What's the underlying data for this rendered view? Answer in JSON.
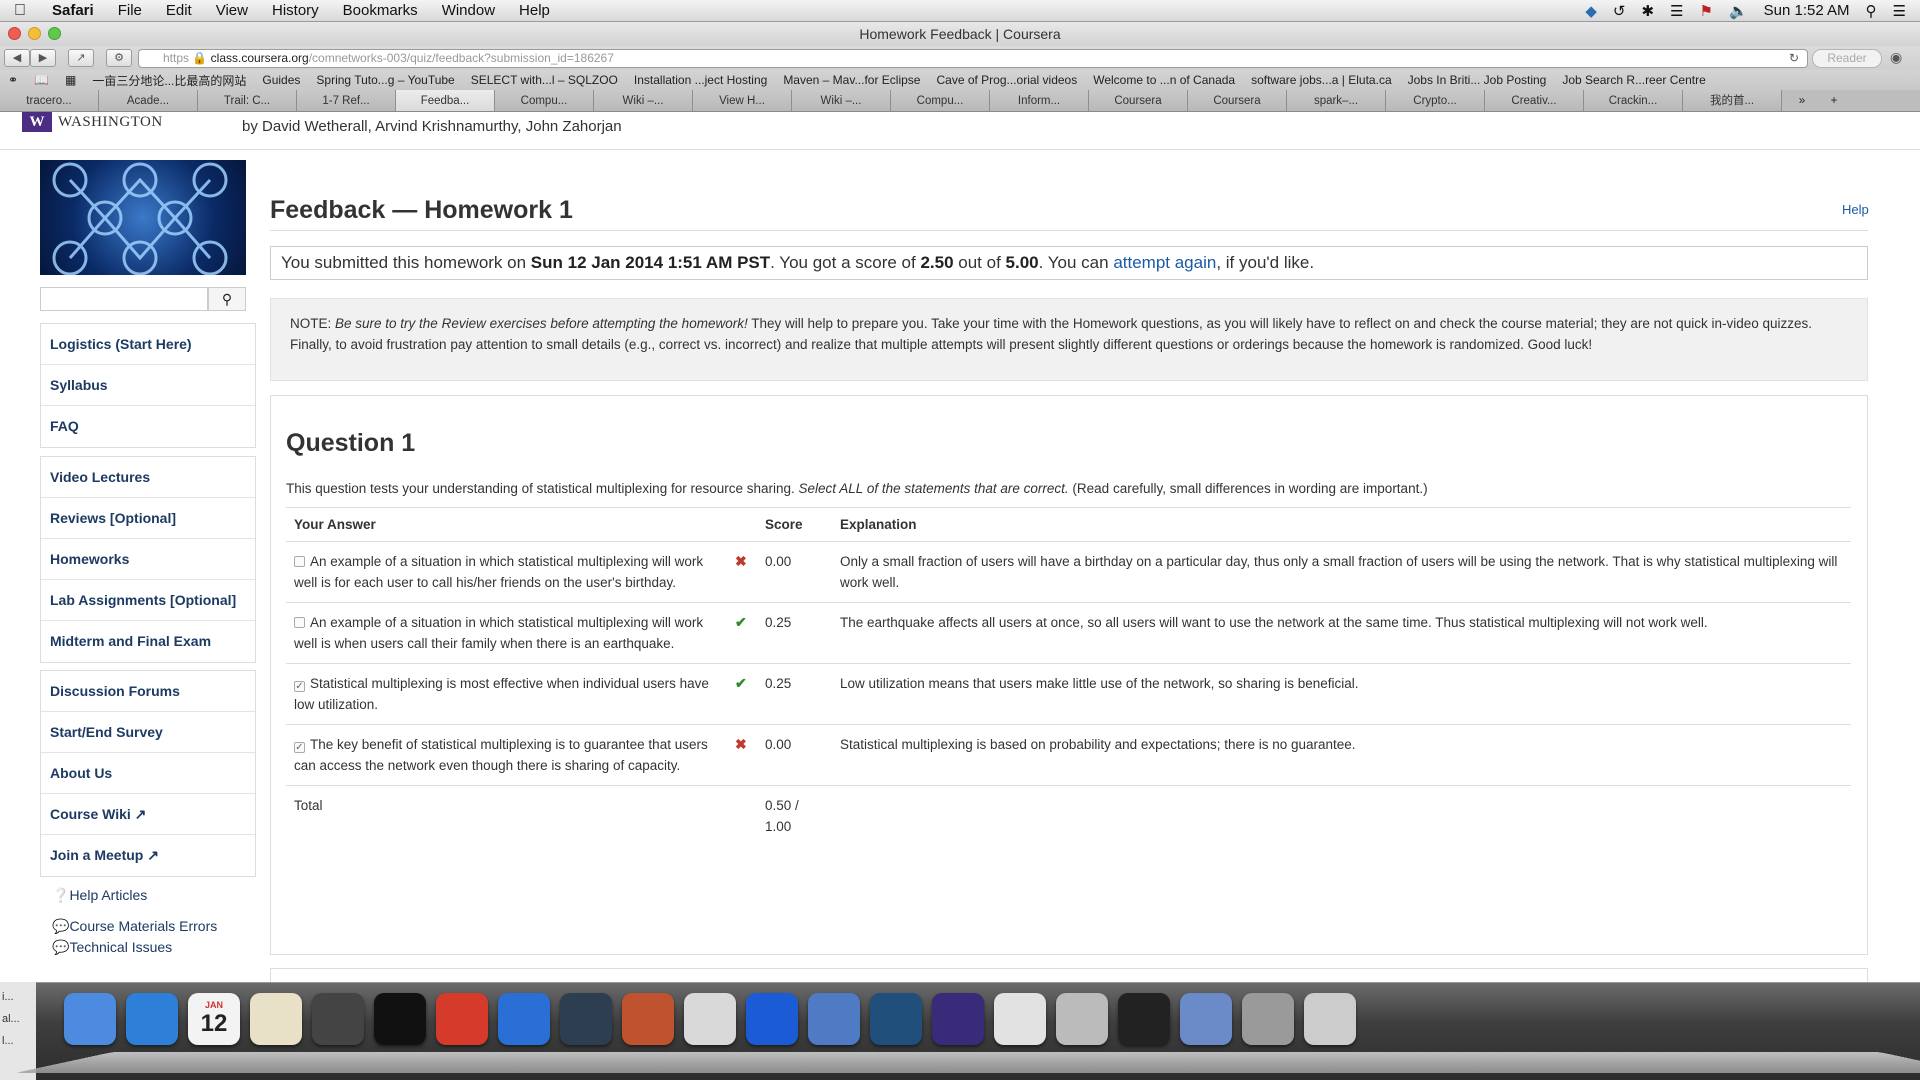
{
  "menubar": {
    "app": "Safari",
    "items": [
      "File",
      "Edit",
      "View",
      "History",
      "Bookmarks",
      "Window",
      "Help"
    ],
    "clock": "Sun 1:52 AM"
  },
  "window": {
    "title": "Homework Feedback | Coursera"
  },
  "toolbar": {
    "url_scheme": "https",
    "url_host": "class.coursera.org",
    "url_path": "/comnetworks-003/quiz/feedback?submission_id=186267",
    "reader_label": "Reader"
  },
  "bookmarks": [
    "一亩三分地论...比最高的网站",
    "Guides",
    "Spring Tuto...g – YouTube",
    "SELECT with...l – SQLZOO",
    "Installation ...ject Hosting",
    "Maven – Mav...for Eclipse",
    "Cave of Prog...orial videos",
    "Welcome to ...n of Canada",
    "software jobs...a | Eluta.ca",
    "Jobs In Briti... Job Posting",
    "Job Search R...reer Centre"
  ],
  "tabs": [
    "tracero...",
    "Acade...",
    "Trail: C...",
    "1-7 Ref...",
    "Feedba...",
    "Compu...",
    "Wiki –...",
    "View H...",
    "Wiki –...",
    "Compu...",
    "Inform...",
    "Coursera",
    "Coursera",
    "spark–...",
    "Crypto...",
    "Creativ...",
    "Crackin...",
    "我的首..."
  ],
  "header": {
    "logo_letter": "W",
    "logo_text": "WASHINGTON",
    "authors": "by David Wetherall, Arvind Krishnamurthy, John Zahorjan"
  },
  "sidebar": {
    "group1": [
      "Logistics (Start Here)",
      "Syllabus",
      "FAQ"
    ],
    "group2": [
      "Video Lectures",
      "Reviews [Optional]",
      "Homeworks",
      "Lab Assignments [Optional]",
      "Midterm and Final Exam"
    ],
    "group3": [
      "Discussion Forums",
      "Start/End Survey",
      "About Us",
      "Course Wiki",
      "Join a Meetup"
    ],
    "help_articles": "Help Articles",
    "course_errors": "Course Materials Errors",
    "tech_issues": "Technical Issues"
  },
  "main": {
    "title": "Feedback — Homework 1",
    "help": "Help",
    "submitted_prefix": "You submitted this homework on ",
    "submitted_date": "Sun 12 Jan 2014 1:51 AM PST",
    "submitted_mid": ". You got a score of ",
    "score": "2.50",
    "out_of": " out of ",
    "max": "5.00",
    "can": ". You can ",
    "attempt_link": "attempt again",
    "suffix": ", if you'd like.",
    "note_prefix": "NOTE: ",
    "note_italic": "Be sure to try the Review exercises before attempting the homework!",
    "note_rest": " They will help to prepare you. Take your time with the Homework questions, as you will likely have to reflect on and check the course material; they are not quick in-video quizzes. Finally, to avoid frustration pay attention to small details (e.g., correct vs. incorrect) and realize that multiple attempts will present slightly different questions or orderings because the homework is randomized. Good luck!"
  },
  "question": {
    "title": "Question 1",
    "text_prefix": "This question tests your understanding of statistical multiplexing for resource sharing. ",
    "text_italic": "Select ALL of the statements that are correct.",
    "text_suffix": " (Read carefully, small differences in wording are important.)",
    "headers": {
      "answer": "Your Answer",
      "score": "Score",
      "explanation": "Explanation"
    },
    "rows": [
      {
        "checked": false,
        "answer": "An example of a situation in which statistical multiplexing will work well is for each user to call his/her friends on the user's birthday.",
        "mark": "✖",
        "correct": false,
        "score": "0.00",
        "explanation": "Only a small fraction of users will have a birthday on a particular day, thus only a small fraction of users will be using the network. That is why statistical multiplexing will work well."
      },
      {
        "checked": false,
        "answer": "An example of a situation in which statistical multiplexing will work well is when users call their family when there is an earthquake.",
        "mark": "✔",
        "correct": true,
        "score": "0.25",
        "explanation": "The earthquake affects all users at once, so all users will want to use the network at the same time. Thus statistical multiplexing will not work well."
      },
      {
        "checked": true,
        "answer": "Statistical multiplexing is most effective when individual users have low utilization.",
        "mark": "✔",
        "correct": true,
        "score": "0.25",
        "explanation": "Low utilization means that users make little use of the network, so sharing is beneficial."
      },
      {
        "checked": true,
        "answer": "The key benefit of statistical multiplexing is to guarantee that users can access the network even though there is sharing of capacity.",
        "mark": "✖",
        "correct": false,
        "score": "0.00",
        "explanation": "Statistical multiplexing is based on probability and expectations; there is no guarantee."
      }
    ],
    "total_label": "Total",
    "total_value": "0.50 / 1.00"
  },
  "colors": {
    "link": "#1a5aa6",
    "nav": "#1d3a63",
    "wrong": "#c0392b",
    "right": "#2e8b2e",
    "uw_purple": "#4b2e83"
  },
  "dock_icons": [
    "finder-icon",
    "safari-icon",
    "calendar-icon",
    "textedit-icon",
    "sublime-icon",
    "terminal-icon",
    "acrobat-icon",
    "word-icon",
    "braces-icon",
    "java-icon",
    "textwrangler-icon",
    "audacity-icon",
    "xcode-icon",
    "mysql-icon",
    "eclipse-icon",
    "chrome-icon",
    "calculator-icon",
    "activity-monitor-icon",
    "preview-icon",
    "utility-icon",
    "trash-icon"
  ],
  "dock_calendar_day": "12",
  "dock_calendar_month": "JAN",
  "leftpanel_lines": [
    "i...",
    "al...",
    "l..."
  ]
}
